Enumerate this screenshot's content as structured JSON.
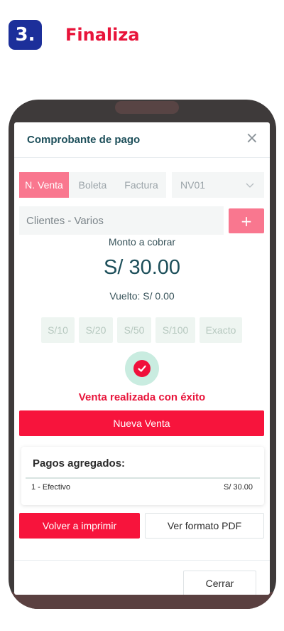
{
  "step": {
    "number": "3.",
    "title": "Finaliza"
  },
  "modal": {
    "title": "Comprobante de pago",
    "close_icon": "close-icon"
  },
  "doc_tabs": [
    {
      "label": "N. Venta",
      "active": true
    },
    {
      "label": "Boleta",
      "active": false
    },
    {
      "label": "Factura",
      "active": false
    }
  ],
  "serie": {
    "value": "NV01"
  },
  "client": {
    "value": "Clientes - Varios",
    "add_label": "+"
  },
  "payment": {
    "monto_label": "Monto a cobrar",
    "monto_value": "S/ 30.00",
    "vuelto": "Vuelto: S/ 0.00"
  },
  "quick_amounts": [
    "S/10",
    "S/20",
    "S/50",
    "S/100",
    "Exacto"
  ],
  "success": {
    "message": "Venta realizada con éxito"
  },
  "buttons": {
    "nueva_venta": "Nueva Venta",
    "reprint": "Volver a imprimir",
    "pdf": "Ver formato PDF",
    "cerrar": "Cerrar"
  },
  "pagos": {
    "title": "Pagos agregados:",
    "items": [
      {
        "method": "1 - Efectivo",
        "amount": "S/ 30.00"
      }
    ]
  },
  "colors": {
    "brand_blue": "#1c2f9a",
    "accent_red": "#f7143c",
    "accent_pink": "#f9778f",
    "success_bg": "#c9ece0"
  }
}
